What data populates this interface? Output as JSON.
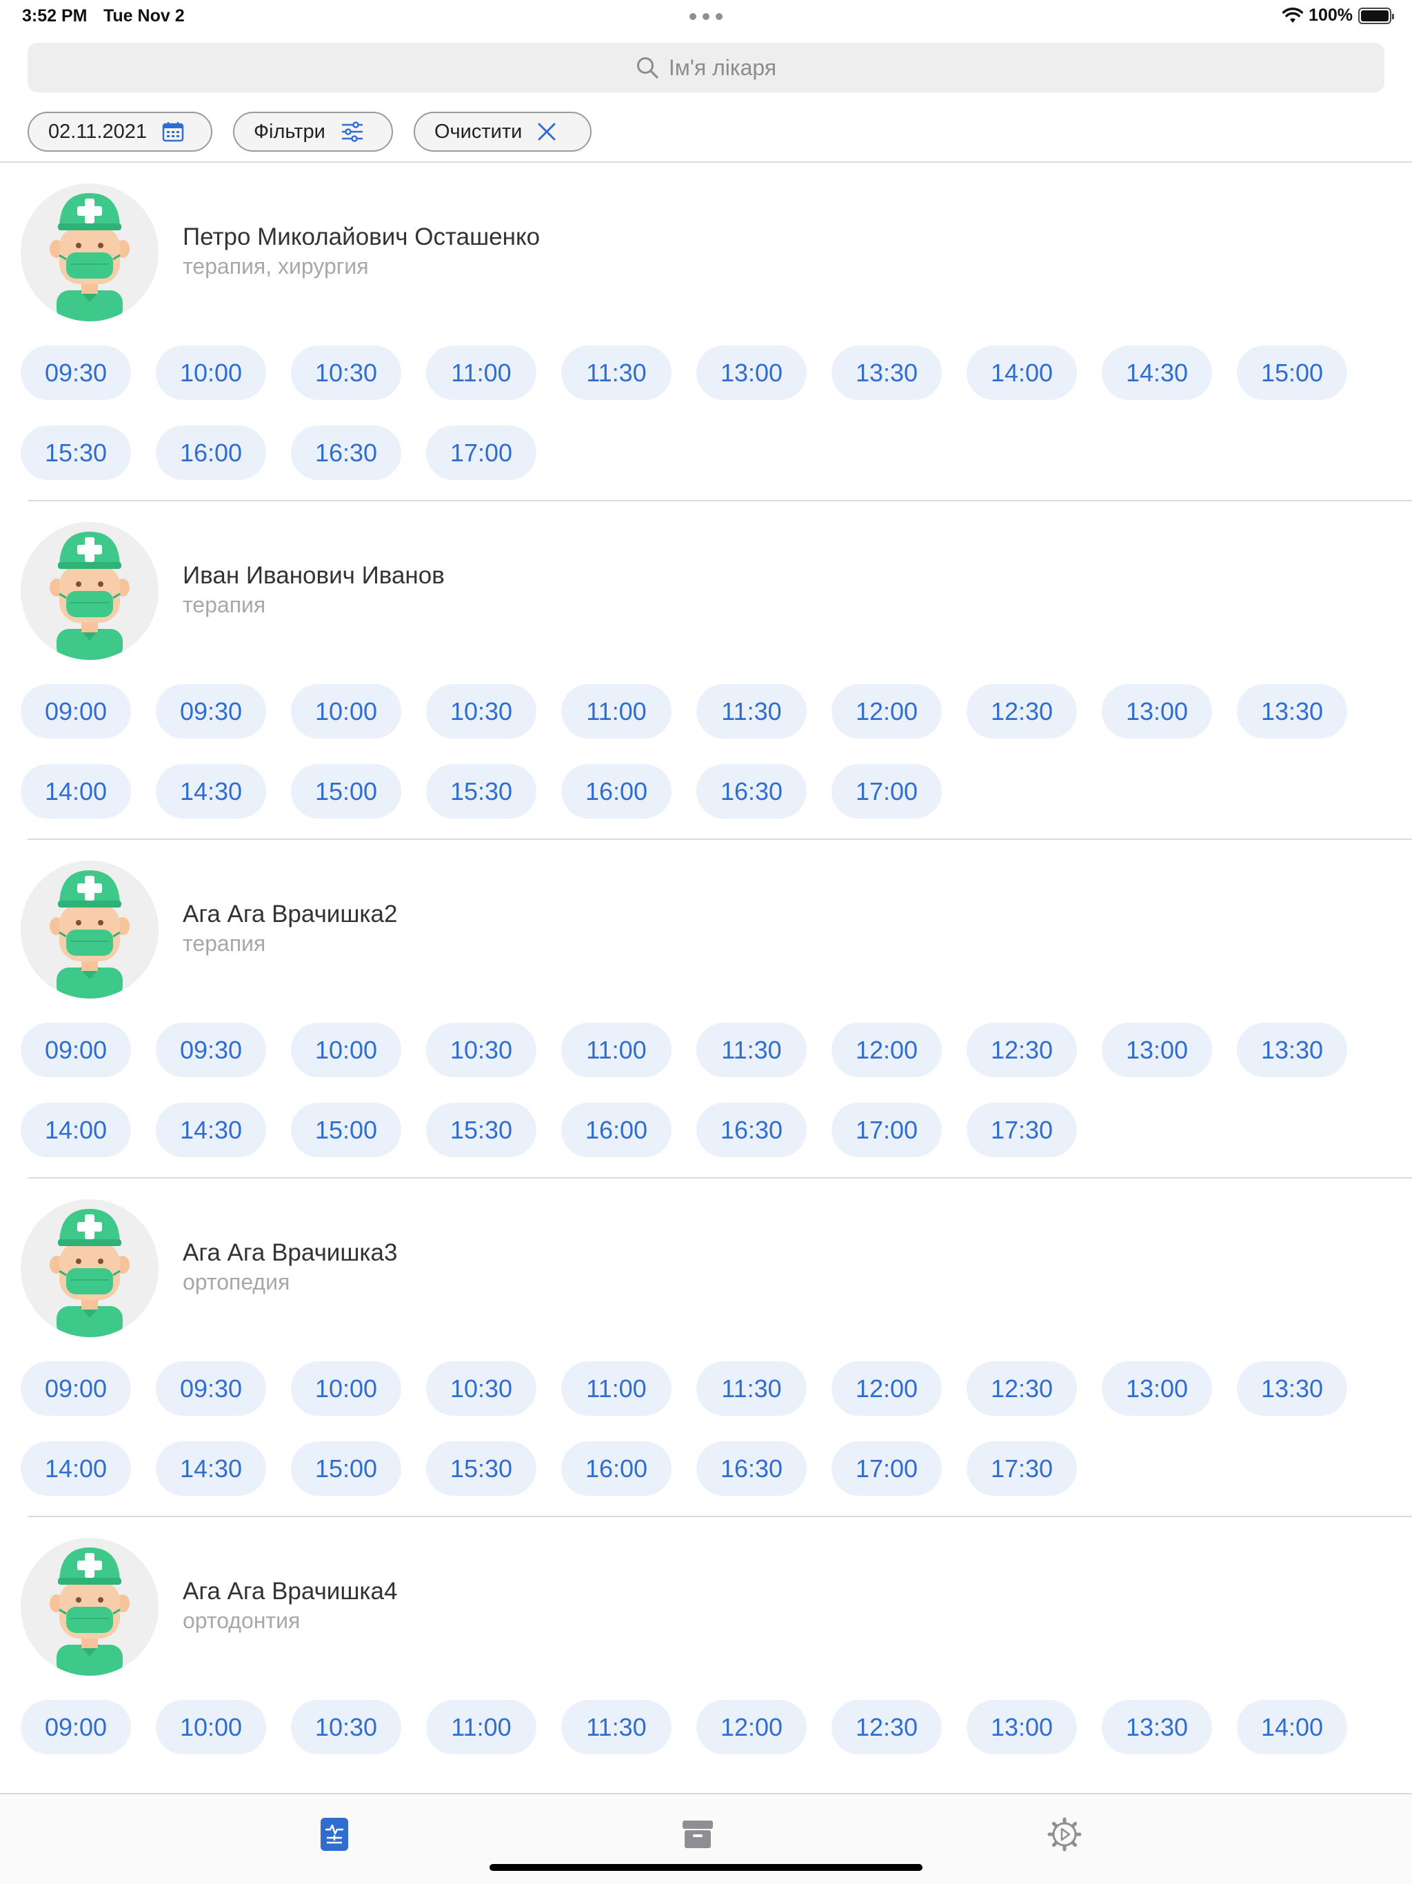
{
  "status_bar": {
    "time": "3:52 PM",
    "date": "Tue Nov 2",
    "battery": "100%"
  },
  "search": {
    "placeholder": "Ім'я лікаря"
  },
  "filters": {
    "date": "02.11.2021",
    "filters_label": "Фільтри",
    "clear_label": "Очистити"
  },
  "colors": {
    "accent": "#2f6ecf",
    "slot_bg": "#ebf1fb",
    "avatar_green": "#3ec98a"
  },
  "doctors": [
    {
      "name": "Петро Миколайович Осташенко",
      "specialty": "терапия, хирургия",
      "slots": [
        "09:30",
        "10:00",
        "10:30",
        "11:00",
        "11:30",
        "13:00",
        "13:30",
        "14:00",
        "14:30",
        "15:00",
        "15:30",
        "16:00",
        "16:30",
        "17:00"
      ]
    },
    {
      "name": "Иван Иванович Иванов",
      "specialty": "терапия",
      "slots": [
        "09:00",
        "09:30",
        "10:00",
        "10:30",
        "11:00",
        "11:30",
        "12:00",
        "12:30",
        "13:00",
        "13:30",
        "14:00",
        "14:30",
        "15:00",
        "15:30",
        "16:00",
        "16:30",
        "17:00"
      ]
    },
    {
      "name": "Ага Ага Врачишка2",
      "specialty": "терапия",
      "slots": [
        "09:00",
        "09:30",
        "10:00",
        "10:30",
        "11:00",
        "11:30",
        "12:00",
        "12:30",
        "13:00",
        "13:30",
        "14:00",
        "14:30",
        "15:00",
        "15:30",
        "16:00",
        "16:30",
        "17:00",
        "17:30"
      ]
    },
    {
      "name": "Ага Ага Врачишка3",
      "specialty": "ортопедия",
      "slots": [
        "09:00",
        "09:30",
        "10:00",
        "10:30",
        "11:00",
        "11:30",
        "12:00",
        "12:30",
        "13:00",
        "13:30",
        "14:00",
        "14:30",
        "15:00",
        "15:30",
        "16:00",
        "16:30",
        "17:00",
        "17:30"
      ]
    },
    {
      "name": "Ага Ага Врачишка4",
      "specialty": "ортодонтия",
      "slots": [
        "09:00",
        "10:00",
        "10:30",
        "11:00",
        "11:30",
        "12:00",
        "12:30",
        "13:00",
        "13:30",
        "14:00"
      ]
    }
  ],
  "tabs": [
    {
      "icon": "schedule-icon",
      "active": true
    },
    {
      "icon": "archive-icon",
      "active": false
    },
    {
      "icon": "settings-icon",
      "active": false
    }
  ]
}
